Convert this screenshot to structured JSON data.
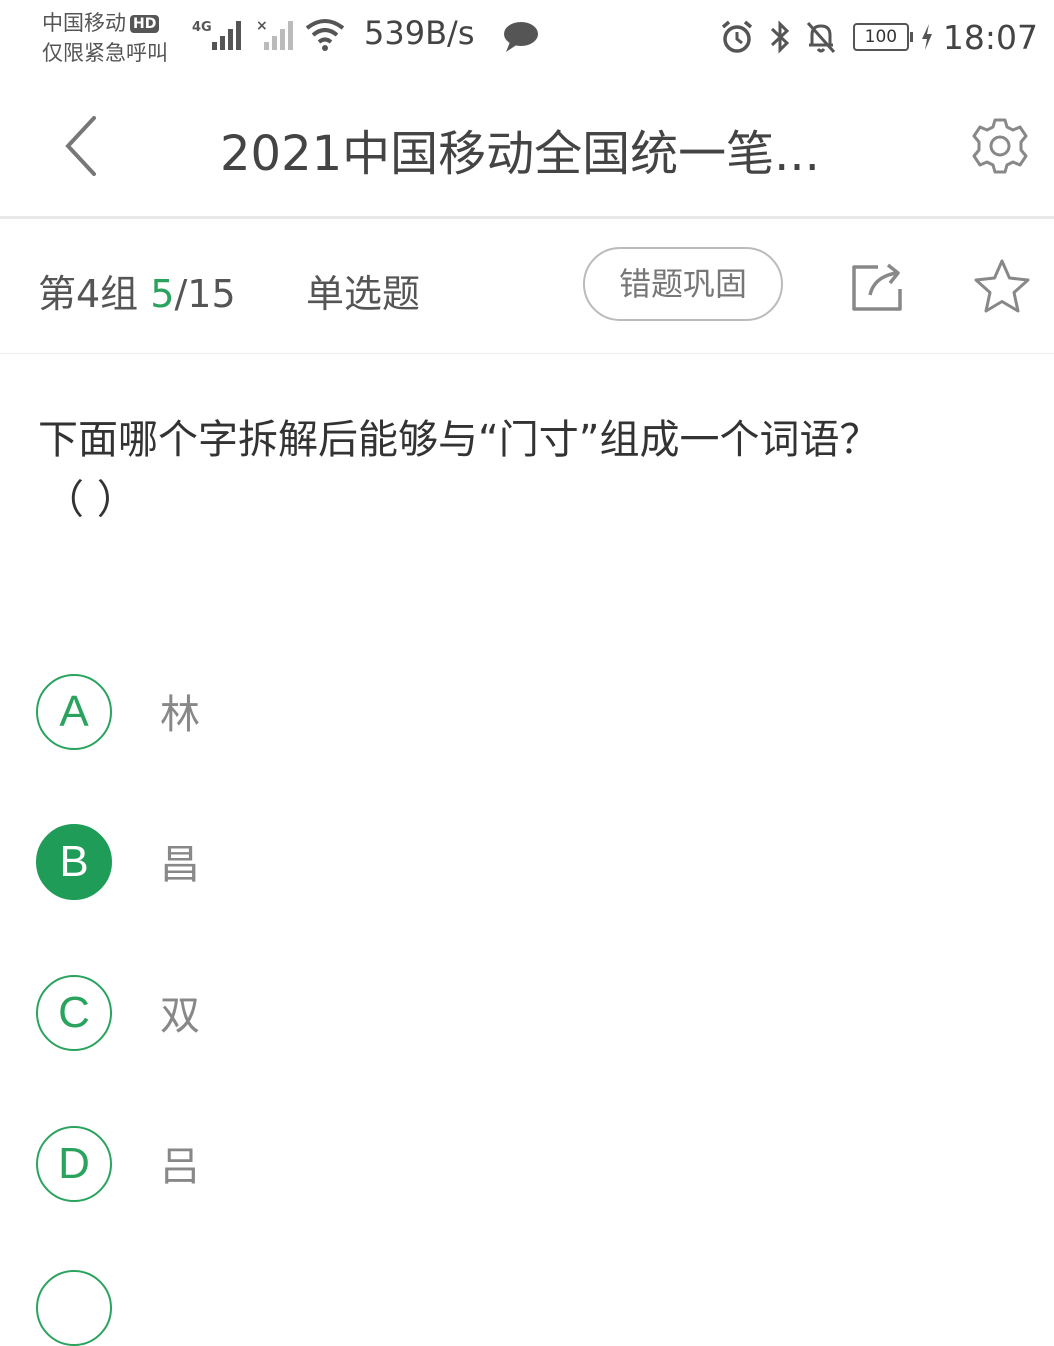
{
  "statusbar": {
    "carrier_line1": "中国移动",
    "hd_badge": "HD",
    "carrier_line2": "仅限紧急呼叫",
    "network": "4G",
    "speed": "539B/s",
    "battery": "100",
    "time": "18:07"
  },
  "nav": {
    "title": "2021中国移动全国统一笔..."
  },
  "question_header": {
    "group": "第4组",
    "progress_current": "5",
    "progress_total": "/15",
    "type": "单选题",
    "review_label": "错题巩固"
  },
  "question": {
    "text": "下面哪个字拆解后能够与“门寸”组成一个词语？",
    "paren": "（ ）"
  },
  "options": [
    {
      "letter": "A",
      "text": "林",
      "selected": false
    },
    {
      "letter": "B",
      "text": "昌",
      "selected": true
    },
    {
      "letter": "C",
      "text": "双",
      "selected": false
    },
    {
      "letter": "D",
      "text": "吕",
      "selected": false
    }
  ],
  "colors": {
    "accent": "#2aa35f",
    "selected_fill": "#1f9c58"
  }
}
